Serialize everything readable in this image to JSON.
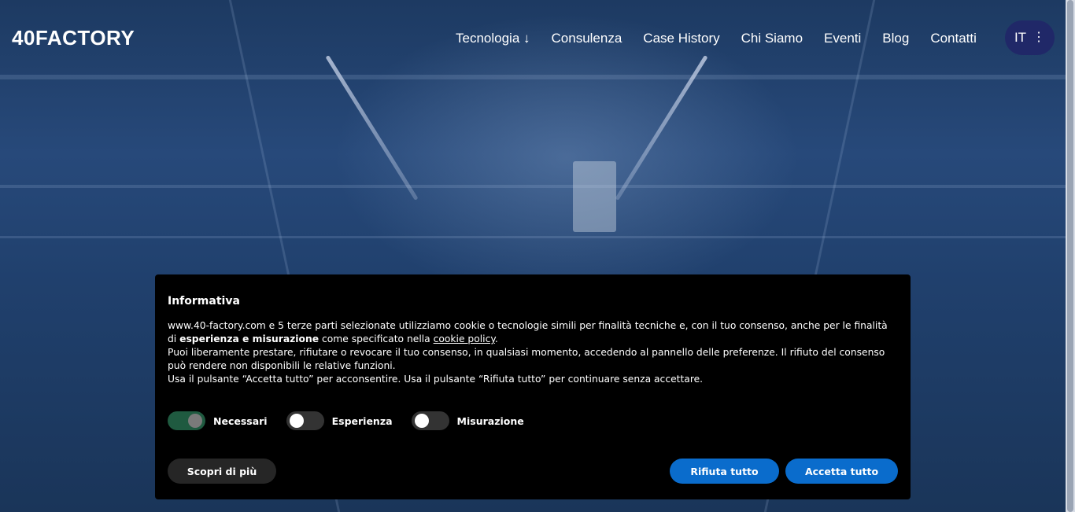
{
  "header": {
    "logo": "40FACTORY",
    "nav": [
      {
        "label": "Tecnologia ↓"
      },
      {
        "label": "Consulenza"
      },
      {
        "label": "Case History"
      },
      {
        "label": "Chi Siamo"
      },
      {
        "label": "Eventi"
      },
      {
        "label": "Blog"
      },
      {
        "label": "Contatti"
      }
    ],
    "language": "IT",
    "language_menu_icon": "⋮"
  },
  "cookie_banner": {
    "title": "Informativa",
    "p1_a": "www.40-factory.com e 5 terze parti selezionate utilizziamo cookie o tecnologie simili per finalità tecniche e, con il tuo consenso, anche per le finalità di ",
    "p1_bold": "esperienza e misurazione",
    "p1_b": " come specificato nella ",
    "p1_link": "cookie policy",
    "p1_c": ".",
    "p2": "Puoi liberamente prestare, rifiutare o revocare il tuo consenso, in qualsiasi momento, accedendo al pannello delle preferenze. Il rifiuto del consenso può rendere non disponibili le relative funzioni.",
    "p3": "Usa il pulsante “Accetta tutto” per acconsentire. Usa il pulsante “Rifiuta tutto” per continuare senza accettare.",
    "toggles": [
      {
        "label": "Necessari",
        "on": true
      },
      {
        "label": "Esperienza",
        "on": false
      },
      {
        "label": "Misurazione",
        "on": false
      }
    ],
    "learn_more": "Scopri di più",
    "reject_all": "Rifiuta tutto",
    "accept_all": "Accetta tutto"
  },
  "colors": {
    "primary_button": "#0a6ccc",
    "lang_pill": "#202868",
    "toggle_on": "#1f5a40"
  }
}
